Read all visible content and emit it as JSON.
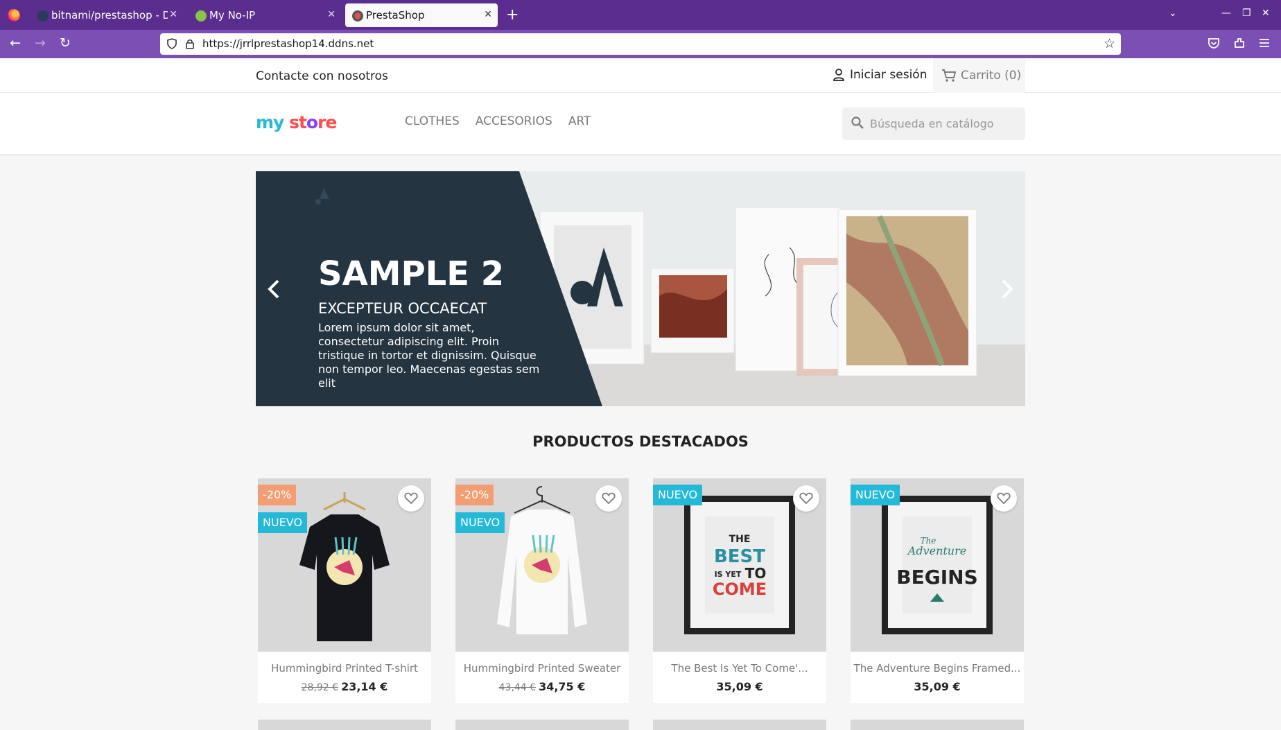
{
  "browser": {
    "tabs": [
      {
        "title": "bitnami/prestashop - Doc",
        "active": false
      },
      {
        "title": "My No-IP",
        "active": false
      },
      {
        "title": "PrestaShop",
        "active": true
      }
    ],
    "url": "https://jrrlprestashop14.ddns.net"
  },
  "header": {
    "contact": "Contacte con nosotros",
    "signin": "Iniciar sesión",
    "cart": "Carrito (0)",
    "logo": {
      "part1": "my",
      "part2": "st",
      "part3": "o",
      "part4": "re"
    },
    "menu": [
      "CLOTHES",
      "ACCESORIOS",
      "ART"
    ],
    "search_placeholder": "Búsqueda en catálogo"
  },
  "carousel": {
    "title": "SAMPLE 2",
    "subtitle": "EXCEPTEUR OCCAECAT",
    "text": "Lorem ipsum dolor sit amet, consectetur adipiscing elit. Proin tristique in tortor et dignissim. Quisque non tempor leo. Maecenas egestas sem elit"
  },
  "featured_title": "PRODUCTOS DESTACADOS",
  "products": [
    {
      "name": "Hummingbird Printed T-shirt",
      "old_price": "28,92 €",
      "price": "23,14 €",
      "discount": "-20%",
      "new_label": "NUEVO"
    },
    {
      "name": "Hummingbird Printed Sweater",
      "old_price": "43,44 €",
      "price": "34,75 €",
      "discount": "-20%",
      "new_label": "NUEVO"
    },
    {
      "name": "The Best Is Yet To Come'...",
      "old_price": "",
      "price": "35,09 €",
      "discount": "",
      "new_label": "NUEVO"
    },
    {
      "name": "The Adventure Begins Framed...",
      "old_price": "",
      "price": "35,09 €",
      "discount": "",
      "new_label": "NUEVO"
    }
  ],
  "posters": {
    "best": [
      "THE",
      "BEST",
      "IS YET",
      "TO",
      "COME"
    ],
    "adventure": [
      "The",
      "Adventure",
      "BEGINS"
    ]
  },
  "colors": {
    "browser_tabbar": "#5b2d8e",
    "browser_toolbar": "#7b4fb3",
    "accent_blue": "#24b9d7",
    "discount_orange": "#f39d72",
    "slide_dark": "#243440"
  }
}
